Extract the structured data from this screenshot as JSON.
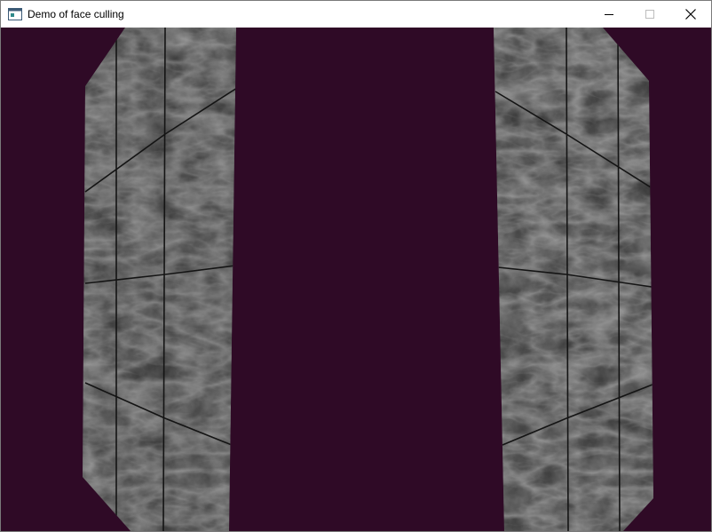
{
  "window": {
    "title": "Demo of face culling",
    "controls": {
      "minimize_icon": "minimize-icon",
      "maximize_icon": "maximize-icon",
      "close_icon": "close-icon"
    }
  },
  "scene": {
    "background_color": "#2f0a26",
    "marble_dark": "#3a3a3a",
    "marble_light": "#5a5a5a",
    "seam_color": "#111111"
  }
}
